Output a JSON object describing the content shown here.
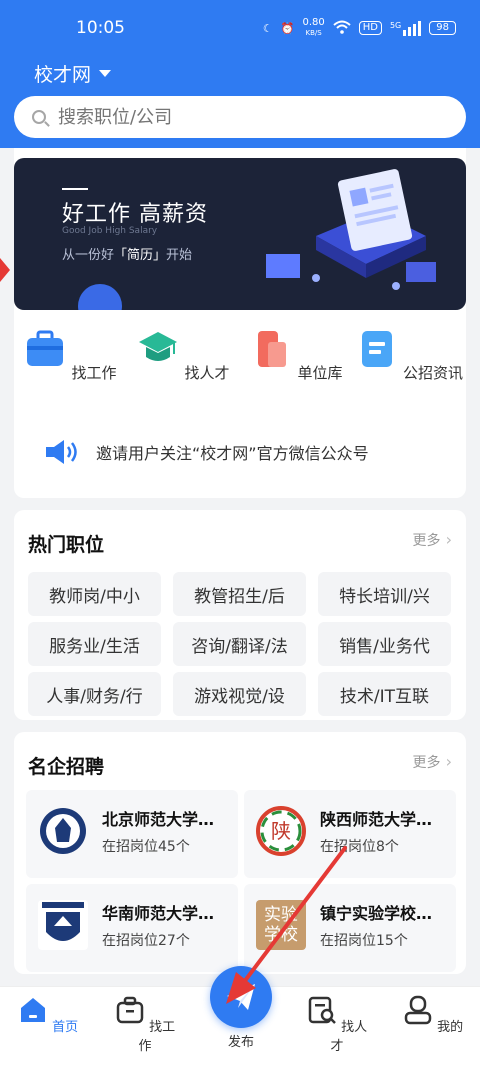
{
  "status": {
    "time": "10:05",
    "speed": "0.80",
    "speed_unit": "KB/S",
    "hd": "HD",
    "net": "5G",
    "battery": "98"
  },
  "header": {
    "city": "校才网"
  },
  "search": {
    "placeholder": "搜索职位/公司"
  },
  "banner": {
    "title": "好工作 高薪资",
    "subtitle": "Good Job  High Salary",
    "tag_prefix": "从一份好",
    "tag_word": "「简历」",
    "tag_suffix": "开始"
  },
  "quick": [
    {
      "label": "找工作",
      "icon": "briefcase-icon"
    },
    {
      "label": "找人才",
      "icon": "graduation-cap-icon"
    },
    {
      "label": "单位库",
      "icon": "building-icon"
    },
    {
      "label": "公招资讯",
      "icon": "news-icon"
    }
  ],
  "notice": "邀请用户关注“校才网”官方微信公众号",
  "hot": {
    "title": "热门职位",
    "more": "更多",
    "tags": [
      "教师岗/中小",
      "教管招生/后",
      "特长培训/兴",
      "服务业/生活",
      "咨询/翻译/法",
      "销售/业务代",
      "人事/财务/行",
      "游戏视觉/设",
      "技术/IT互联"
    ]
  },
  "famous": {
    "title": "名企招聘",
    "more": "更多",
    "companies": [
      {
        "name": "北京师范大学…",
        "count": "在招岗位45个"
      },
      {
        "name": "陕西师范大学…",
        "count": "在招岗位8个",
        "logo_text": "陕"
      },
      {
        "name": "华南师范大学…",
        "count": "在招岗位27个"
      },
      {
        "name": "镇宁实验学校…",
        "count": "在招岗位15个",
        "logo_text": "实验学校"
      }
    ]
  },
  "tabbar": {
    "home": "首页",
    "jobs": "找工作",
    "post": "发布",
    "talent": "找人才",
    "mine": "我的"
  },
  "colors": {
    "primary": "#2f7bf2",
    "arrow": "#e53935",
    "banner_bg": "#1c2338"
  }
}
